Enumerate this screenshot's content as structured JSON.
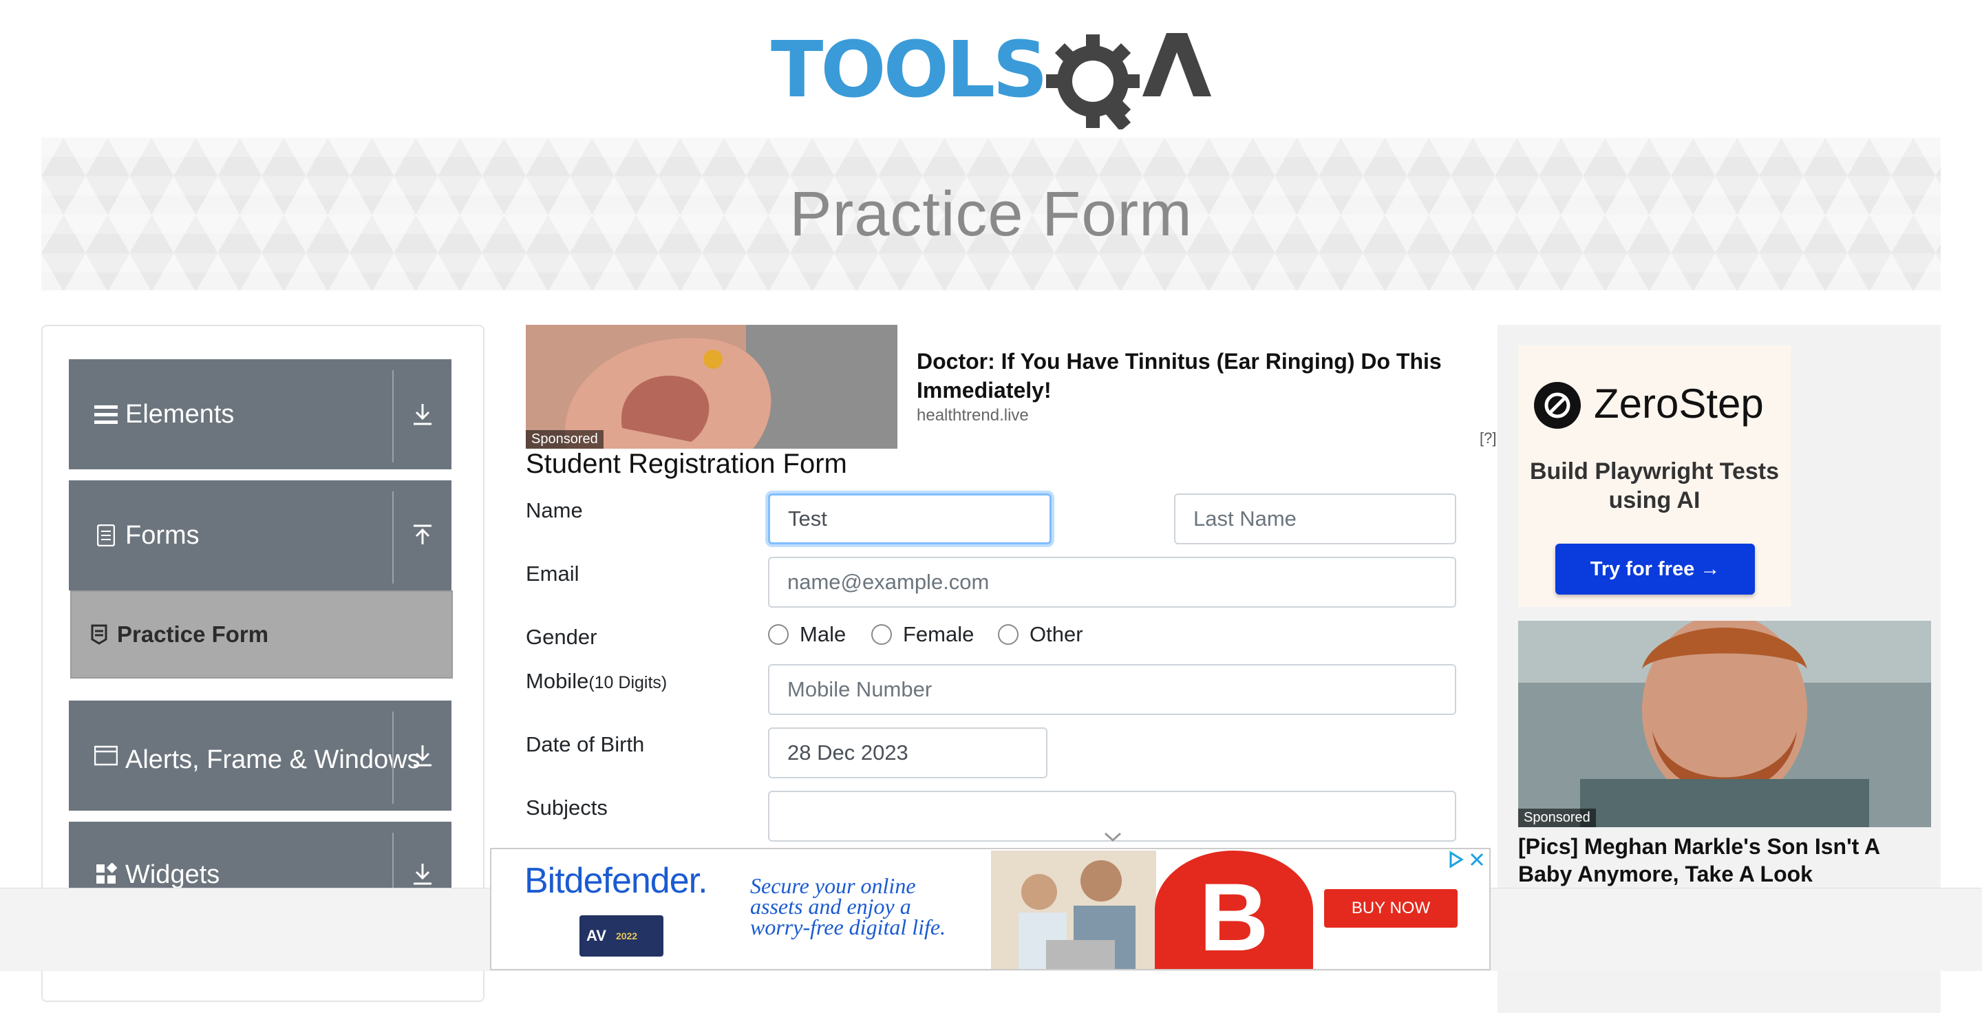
{
  "header": {
    "logo_text": "TOOLSQA"
  },
  "banner": {
    "title": "Practice Form"
  },
  "sidebar": {
    "groups": [
      {
        "label": "Elements",
        "icon": "hamburger-icon",
        "arrow": "download-arrow-icon"
      },
      {
        "label": "Forms",
        "icon": "document-icon",
        "arrow": "upload-arrow-icon"
      },
      {
        "label": "Alerts, Frame & Windows",
        "icon": "window-icon",
        "arrow": "download-arrow-icon"
      },
      {
        "label": "Widgets",
        "icon": "widgets-icon",
        "arrow": "download-arrow-icon"
      }
    ],
    "active_item": {
      "label": "Practice Form",
      "icon": "form-icon"
    }
  },
  "ad_top": {
    "title": "Doctor: If You Have Tinnitus (Ear Ringing) Do This Immediately!",
    "source": "healthtrend.live",
    "sponsored": "Sponsored",
    "help": "[?]"
  },
  "form": {
    "title": "Student Registration Form",
    "name_label": "Name",
    "first_name_value": "Test",
    "first_name_placeholder": "First Name",
    "last_name_placeholder": "Last Name",
    "email_label": "Email",
    "email_placeholder": "name@example.com",
    "gender_label": "Gender",
    "gender_options": [
      "Male",
      "Female",
      "Other"
    ],
    "mobile_label": "Mobile",
    "mobile_hint": "(10 Digits)",
    "mobile_placeholder": "Mobile Number",
    "dob_label": "Date of Birth",
    "dob_value": "28 Dec 2023",
    "subjects_label": "Subjects"
  },
  "right_ad": {
    "brand": "ZeroStep",
    "subtitle": "Build Playwright Tests using AI",
    "button": "Try for free →",
    "sponsored": "Sponsored",
    "caption": "[Pics] Meghan Markle's Son Isn't A Baby Anymore, Take A Look"
  },
  "bottom_ad": {
    "brand": "Bitdefender.",
    "tagline": "Secure your online assets and enjoy a worry-free digital life.",
    "badge": "AV",
    "badge_year": "2022",
    "button": "BUY NOW",
    "logo_letter": "B"
  },
  "colors": {
    "sidebar_group": "#6c757d",
    "active_item": "#aaaaaa",
    "focus_border": "#80bdff",
    "zerostep_button": "#0a3bdc",
    "bitdefender_red": "#e42a1e",
    "bitdefender_blue": "#1a5bd1"
  }
}
